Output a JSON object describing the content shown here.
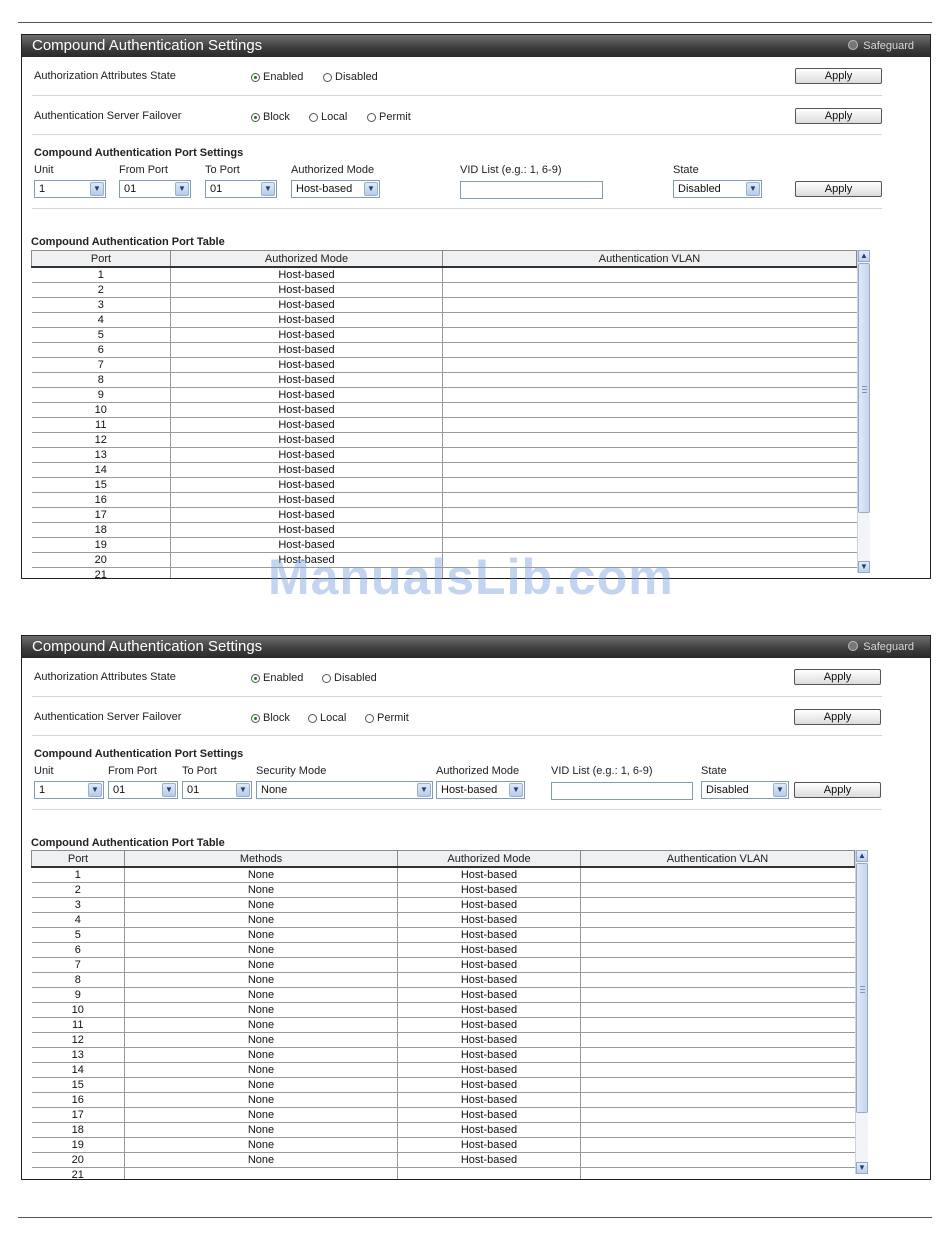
{
  "watermark": "ManualsLib.com",
  "panel1": {
    "title": "Compound Authentication Settings",
    "safeguard": "Safeguard",
    "auth_attr": {
      "label": "Authorization Attributes State",
      "options": [
        "Enabled",
        "Disabled"
      ],
      "selected": "Enabled",
      "apply": "Apply"
    },
    "failover": {
      "label": "Authentication Server Failover",
      "options": [
        "Block",
        "Local",
        "Permit"
      ],
      "selected": "Block",
      "apply": "Apply"
    },
    "port_settings": {
      "heading": "Compound Authentication Port Settings",
      "unit_label": "Unit",
      "unit_value": "1",
      "from_label": "From Port",
      "from_value": "01",
      "to_label": "To Port",
      "to_value": "01",
      "mode_label": "Authorized Mode",
      "mode_value": "Host-based",
      "vid_label": "VID List (e.g.: 1, 6-9)",
      "vid_value": "",
      "state_label": "State",
      "state_value": "Disabled",
      "apply": "Apply"
    },
    "table": {
      "heading": "Compound Authentication Port Table",
      "columns": [
        "Port",
        "Authorized Mode",
        "Authentication VLAN"
      ],
      "rows": [
        [
          "1",
          "Host-based",
          ""
        ],
        [
          "2",
          "Host-based",
          ""
        ],
        [
          "3",
          "Host-based",
          ""
        ],
        [
          "4",
          "Host-based",
          ""
        ],
        [
          "5",
          "Host-based",
          ""
        ],
        [
          "6",
          "Host-based",
          ""
        ],
        [
          "7",
          "Host-based",
          ""
        ],
        [
          "8",
          "Host-based",
          ""
        ],
        [
          "9",
          "Host-based",
          ""
        ],
        [
          "10",
          "Host-based",
          ""
        ],
        [
          "11",
          "Host-based",
          ""
        ],
        [
          "12",
          "Host-based",
          ""
        ],
        [
          "13",
          "Host-based",
          ""
        ],
        [
          "14",
          "Host-based",
          ""
        ],
        [
          "15",
          "Host-based",
          ""
        ],
        [
          "16",
          "Host-based",
          ""
        ],
        [
          "17",
          "Host-based",
          ""
        ],
        [
          "18",
          "Host-based",
          ""
        ],
        [
          "19",
          "Host-based",
          ""
        ],
        [
          "20",
          "Host-based",
          ""
        ],
        [
          "21",
          "",
          ""
        ]
      ]
    }
  },
  "panel2": {
    "title": "Compound Authentication Settings",
    "safeguard": "Safeguard",
    "auth_attr": {
      "label": "Authorization Attributes State",
      "options": [
        "Enabled",
        "Disabled"
      ],
      "selected": "Enabled",
      "apply": "Apply"
    },
    "failover": {
      "label": "Authentication Server Failover",
      "options": [
        "Block",
        "Local",
        "Permit"
      ],
      "selected": "Block",
      "apply": "Apply"
    },
    "port_settings": {
      "heading": "Compound Authentication Port Settings",
      "unit_label": "Unit",
      "unit_value": "1",
      "from_label": "From Port",
      "from_value": "01",
      "to_label": "To Port",
      "to_value": "01",
      "security_label": "Security Mode",
      "security_value": "None",
      "mode_label": "Authorized Mode",
      "mode_value": "Host-based",
      "vid_label": "VID List (e.g.: 1, 6-9)",
      "vid_value": "",
      "state_label": "State",
      "state_value": "Disabled",
      "apply": "Apply"
    },
    "table": {
      "heading": "Compound Authentication Port Table",
      "columns": [
        "Port",
        "Methods",
        "Authorized Mode",
        "Authentication VLAN"
      ],
      "rows": [
        [
          "1",
          "None",
          "Host-based",
          ""
        ],
        [
          "2",
          "None",
          "Host-based",
          ""
        ],
        [
          "3",
          "None",
          "Host-based",
          ""
        ],
        [
          "4",
          "None",
          "Host-based",
          ""
        ],
        [
          "5",
          "None",
          "Host-based",
          ""
        ],
        [
          "6",
          "None",
          "Host-based",
          ""
        ],
        [
          "7",
          "None",
          "Host-based",
          ""
        ],
        [
          "8",
          "None",
          "Host-based",
          ""
        ],
        [
          "9",
          "None",
          "Host-based",
          ""
        ],
        [
          "10",
          "None",
          "Host-based",
          ""
        ],
        [
          "11",
          "None",
          "Host-based",
          ""
        ],
        [
          "12",
          "None",
          "Host-based",
          ""
        ],
        [
          "13",
          "None",
          "Host-based",
          ""
        ],
        [
          "14",
          "None",
          "Host-based",
          ""
        ],
        [
          "15",
          "None",
          "Host-based",
          ""
        ],
        [
          "16",
          "None",
          "Host-based",
          ""
        ],
        [
          "17",
          "None",
          "Host-based",
          ""
        ],
        [
          "18",
          "None",
          "Host-based",
          ""
        ],
        [
          "19",
          "None",
          "Host-based",
          ""
        ],
        [
          "20",
          "None",
          "Host-based",
          ""
        ],
        [
          "21",
          "",
          "",
          ""
        ]
      ]
    }
  }
}
